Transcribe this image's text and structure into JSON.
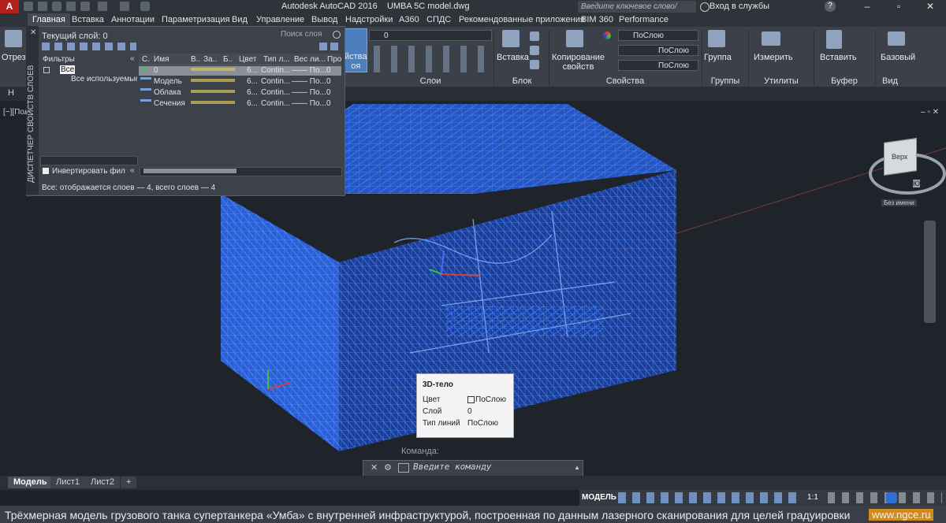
{
  "app": {
    "title": "Autodesk AutoCAD 2016",
    "filename": "UMBA 5C model.dwg",
    "search_placeholder": "Введите ключевое слово/фразу",
    "sign_in": "Вход в службы",
    "help": "?"
  },
  "ribbon_tabs": [
    "Главная",
    "Вставка",
    "Аннотации",
    "Параметризация",
    "Вид",
    "Управление",
    "Вывод",
    "Надстройки",
    "A360",
    "СПДС",
    "Рекомендованные приложения",
    "BIM 360",
    "Performance"
  ],
  "ribbon": {
    "cut_label": "Отрезо",
    "layer_props_label": "йства\nоя",
    "layer_combo": "0",
    "layers_panel": "Слои",
    "insert_label": "Вставка",
    "block_panel": "Блок",
    "copy_props_label": "Копирование\nсвойств",
    "bylayer_color": "ПоСлою",
    "bylayer_lt": "ПоСлою",
    "bylayer_lw": "ПоСлою",
    "properties_panel": "Свойства",
    "group_label": "Группа",
    "groups_panel": "Группы",
    "measure_label": "Измерить",
    "utilities_panel": "Утилиты",
    "paste_label": "Вставить",
    "clipboard_panel": "Буфер обмена",
    "base_label": "Базовый",
    "view_panel": "Вид"
  },
  "viewport": {
    "label": "[−][Пол",
    "tab_label": "Н"
  },
  "layer_palette": {
    "current_layer": "Текущий слой: 0",
    "search_placeholder": "Поиск слоя",
    "filters_label": "Фильтры",
    "tree_all": "Все",
    "tree_used": "Все используемые слои",
    "invert_filter": "Инвертировать фил",
    "vertical_title": "ДИСПЕТЧЕР СВОЙСТВ СЛОЕВ",
    "status": "Все: отображается слоев — 4, всего слоев — 4",
    "columns": [
      "С.",
      "Имя",
      "В..",
      "За..",
      "Б..",
      "Цвет",
      "Тип л...",
      "Вес ли...",
      "Про"
    ],
    "rows": [
      {
        "name": "0",
        "color": "6...",
        "linetype": "Contin...",
        "lineweight": "—— По...",
        "plot": "0"
      },
      {
        "name": "Модель",
        "color": "6...",
        "linetype": "Contin...",
        "lineweight": "—— По...",
        "plot": "0"
      },
      {
        "name": "Облака",
        "color": "6...",
        "linetype": "Contin...",
        "lineweight": "—— По...",
        "plot": "0"
      },
      {
        "name": "Сечения",
        "color": "6...",
        "linetype": "Contin...",
        "lineweight": "—— По...",
        "plot": "0"
      }
    ]
  },
  "tooltip": {
    "title": "3D-тело",
    "color_label": "Цвет",
    "color_value": "ПоСлою",
    "layer_label": "Слой",
    "layer_value": "0",
    "linetype_label": "Тип линий",
    "linetype_value": "ПоСлою"
  },
  "command": {
    "label": "Команда:",
    "placeholder": "Введите команду"
  },
  "viewcube": {
    "face": "Верх",
    "compass": "Ю",
    "wcs": "Без имени"
  },
  "layout_tabs": [
    "Модель",
    "Лист1",
    "Лист2",
    "+"
  ],
  "status_bar": {
    "mode": "МОДЕЛЬ",
    "scale": "1:1"
  },
  "caption": {
    "text": "Трёхмерная модель грузового танка супертанкера «Умба» с внутренней инфраструктурой, построенная по данным лазерного сканирования для целей градуировки",
    "site": "www.ngce.ru"
  },
  "colors": {
    "wireframe": "#3f7fff",
    "background": "#1f242b",
    "panel": "#3d424a",
    "accent_red": "#b3211e"
  }
}
